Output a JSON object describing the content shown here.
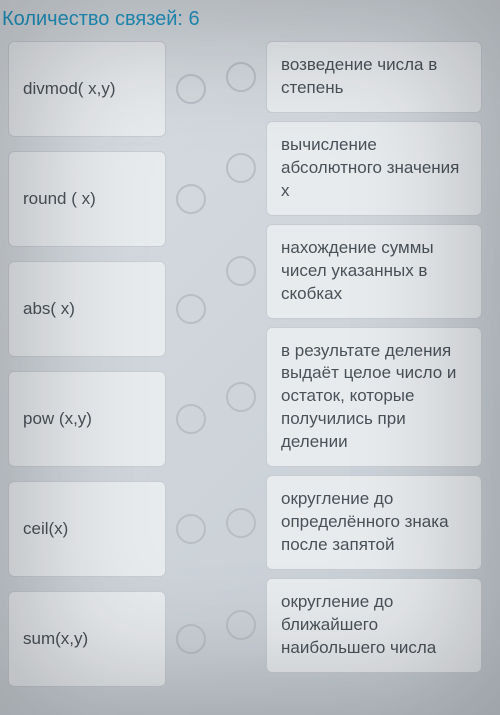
{
  "header": {
    "title": "Количество связей: 6"
  },
  "left_items": [
    {
      "label": "divmod( x,y)"
    },
    {
      "label": "round ( x)"
    },
    {
      "label": "abs( x)"
    },
    {
      "label": "pow (x,y)"
    },
    {
      "label": "ceil(x)"
    },
    {
      "label": "sum(x,y)"
    }
  ],
  "right_items": [
    {
      "label": "возведение числа в степень"
    },
    {
      "label": "вычисление абсолютного значения x"
    },
    {
      "label": "нахождение суммы чисел указанных в скобках"
    },
    {
      "label": "в результате деления выдаёт целое число и остаток, которые получились при делении"
    },
    {
      "label": "округление до определённого знака после запятой"
    },
    {
      "label": "округление до ближайшего наибольшего числа"
    }
  ]
}
